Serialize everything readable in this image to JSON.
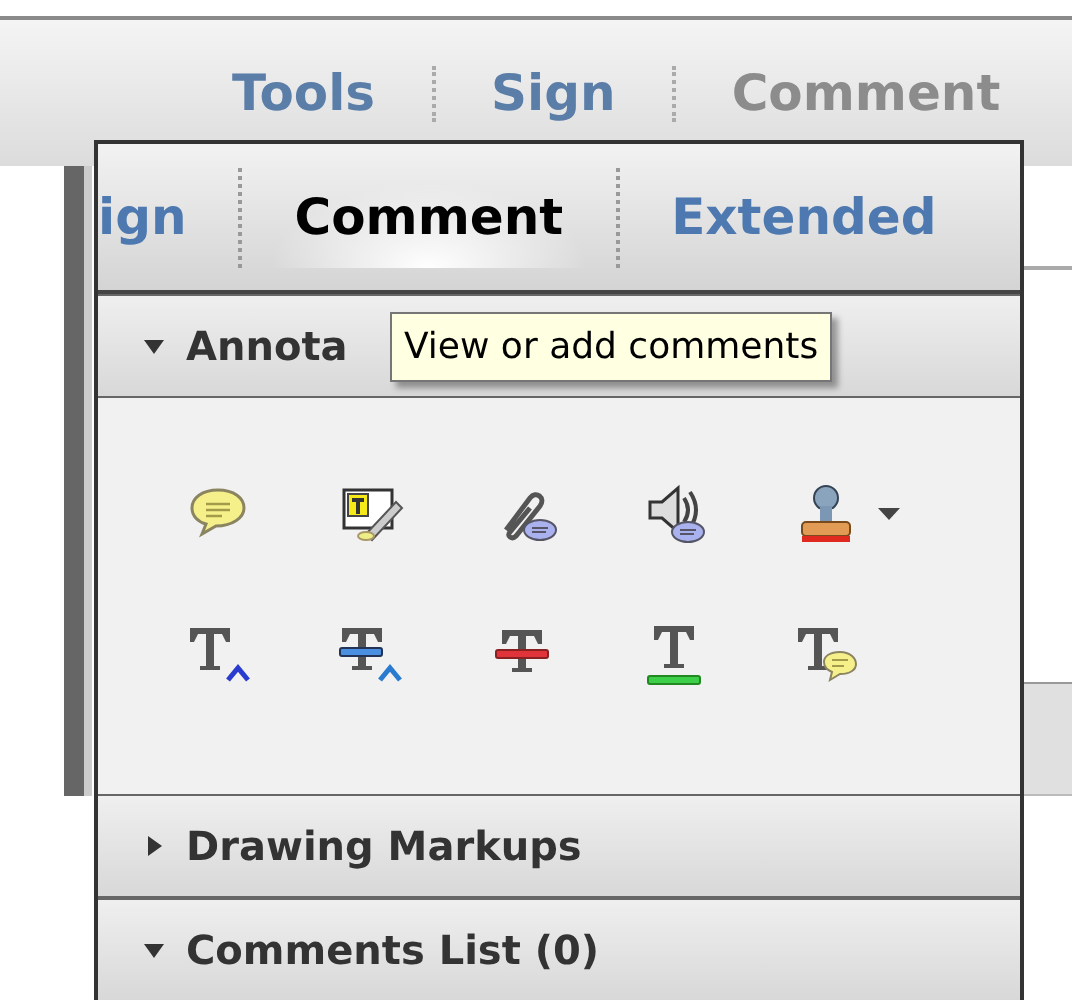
{
  "background_toolbar": {
    "tabs": [
      {
        "label": "Tools",
        "selected": false
      },
      {
        "label": "Sign",
        "selected": false
      },
      {
        "label": "Comment",
        "selected": true
      }
    ]
  },
  "panel": {
    "tabs": [
      {
        "label": "ign",
        "selected": false
      },
      {
        "label": "Comment",
        "selected": true
      },
      {
        "label": "Extended",
        "selected": false
      }
    ],
    "sections": [
      {
        "title": "Annota",
        "expanded": true,
        "tools": [
          {
            "kind": "note",
            "has_menu": false
          },
          {
            "kind": "textbox",
            "has_menu": false
          },
          {
            "kind": "attach",
            "has_menu": false
          },
          {
            "kind": "sound",
            "has_menu": false
          },
          {
            "kind": "stamp",
            "has_menu": true
          },
          {
            "kind": "insert",
            "has_menu": false
          },
          {
            "kind": "replace",
            "has_menu": false
          },
          {
            "kind": "strike",
            "has_menu": false
          },
          {
            "kind": "underline",
            "has_menu": false
          },
          {
            "kind": "textnote",
            "has_menu": false
          }
        ]
      },
      {
        "title": "Drawing Markups",
        "expanded": false
      },
      {
        "title": "Comments List (0)",
        "expanded": true
      }
    ]
  },
  "tooltip": {
    "text": "View or add comments"
  }
}
